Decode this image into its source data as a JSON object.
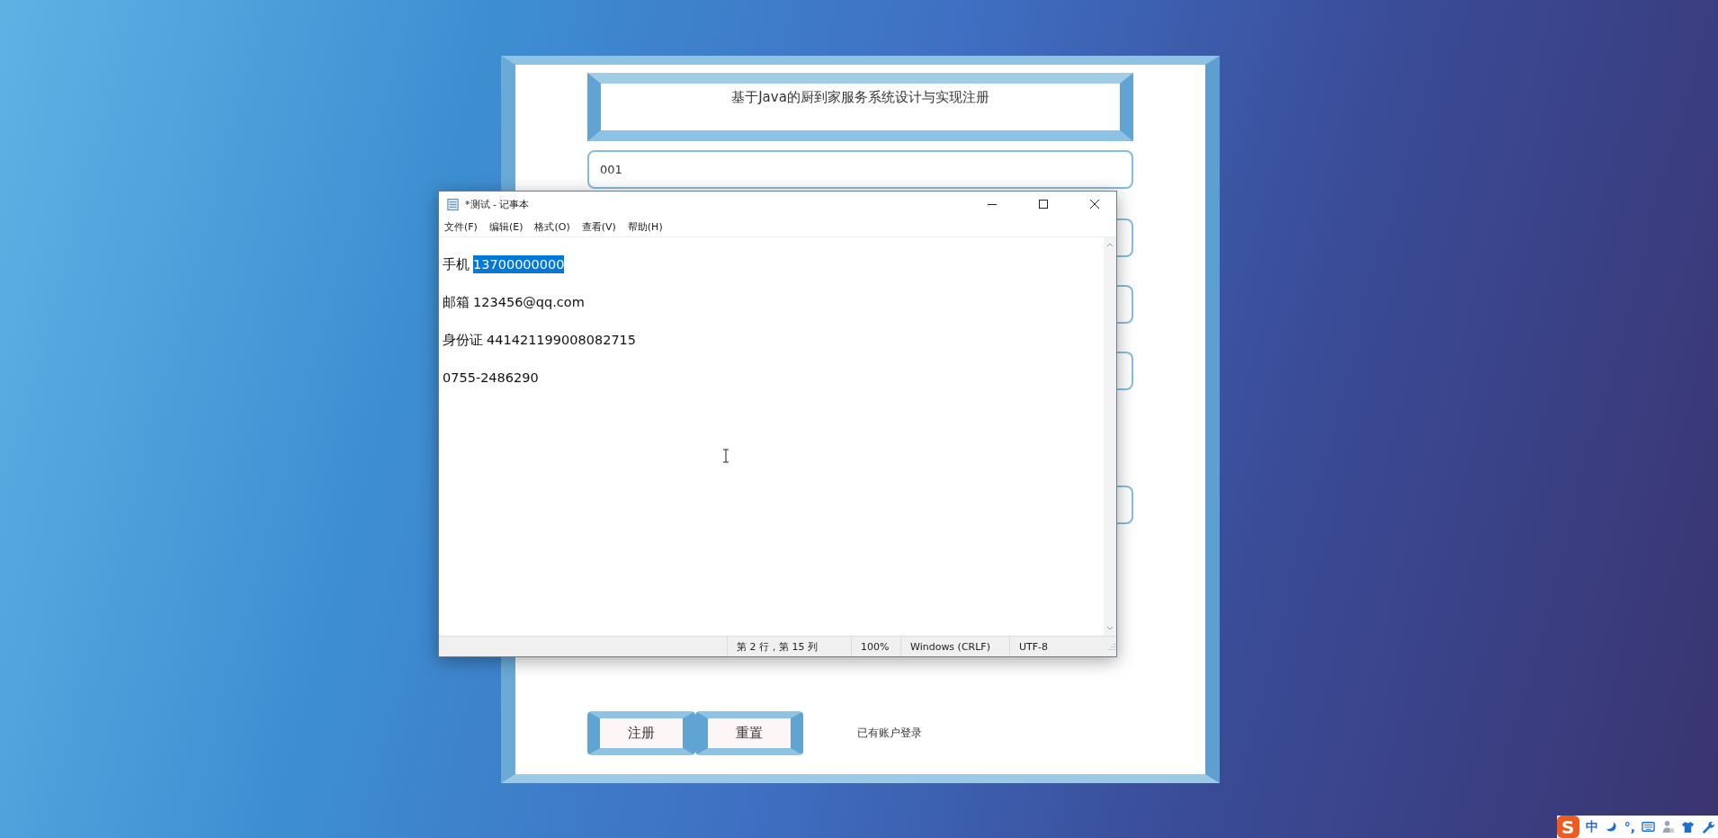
{
  "form": {
    "title": "基于Java的厨到家服务系统设计与实现注册",
    "fields": [
      {
        "kind": "text",
        "value": "001"
      },
      {
        "kind": "covered"
      },
      {
        "kind": "covered"
      },
      {
        "kind": "covered"
      },
      {
        "kind": "covered"
      }
    ],
    "buttons": [
      "注册",
      "重置"
    ],
    "login_link": "已有账户登录"
  },
  "notepad": {
    "title": "*测试 - 记事本",
    "menu": [
      "文件(F)",
      "编辑(E)",
      "格式(O)",
      "查看(V)",
      "帮助(H)"
    ],
    "lines": [
      {
        "segments": [
          {
            "text": "手机",
            "selected": false
          },
          {
            "text": "13700000000",
            "selected": true
          }
        ]
      },
      {
        "segments": [
          {
            "text": "邮箱",
            "selected": false
          },
          {
            "text": "123456@qq.com",
            "selected": false
          }
        ]
      },
      {
        "segments": [
          {
            "text": "身份证",
            "selected": false
          },
          {
            "text": "441421199008082715",
            "selected": false
          }
        ]
      },
      {
        "segments": [
          {
            "text": "0755-2486290",
            "selected": false
          }
        ]
      }
    ],
    "status_bar": [
      "第 2 行，第 15 列",
      "100%",
      "Windows (CRLF)",
      "UTF-8"
    ]
  },
  "tray": [
    {
      "kind": "logo",
      "text": "S"
    },
    {
      "kind": "text",
      "text": "中"
    },
    {
      "kind": "moon"
    },
    {
      "kind": "text",
      "text": "°,"
    },
    {
      "kind": "keyboard"
    },
    {
      "kind": "user"
    },
    {
      "kind": "shirt"
    },
    {
      "kind": "wrench"
    }
  ]
}
